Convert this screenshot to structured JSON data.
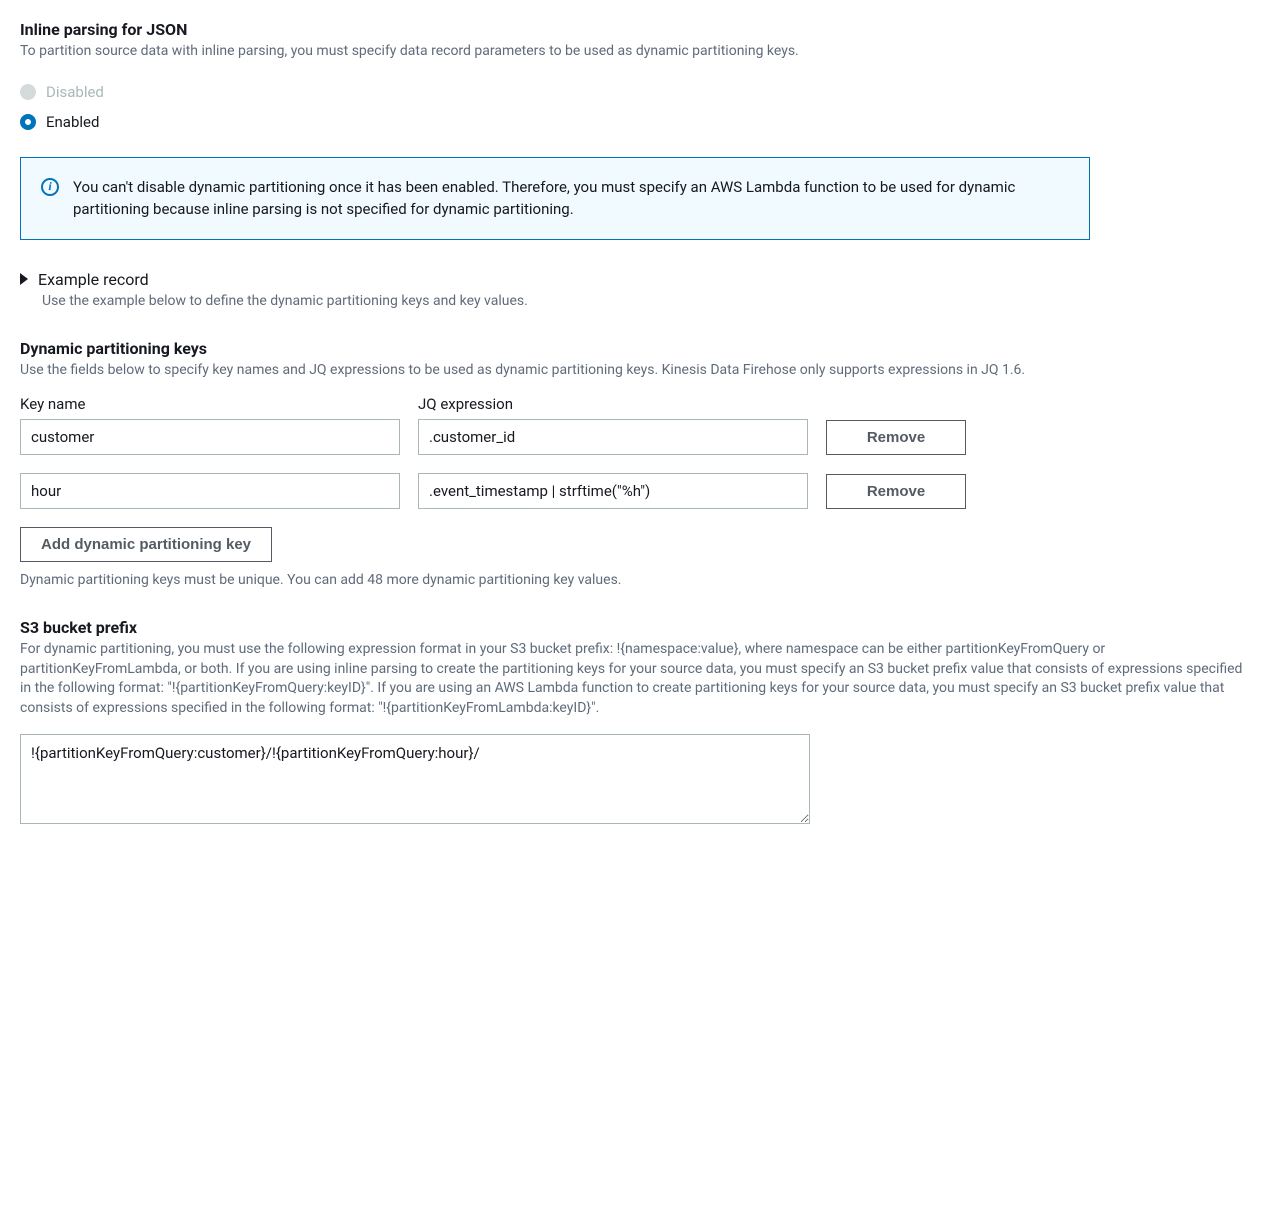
{
  "inlineParsing": {
    "title": "Inline parsing for JSON",
    "description": "To partition source data with inline parsing, you must specify data record parameters to be used as dynamic partitioning keys.",
    "options": {
      "disabled_label": "Disabled",
      "enabled_label": "Enabled"
    }
  },
  "alert": {
    "text": "You can't disable dynamic partitioning once it has been enabled. Therefore, you must specify an AWS Lambda function to be used for dynamic partitioning because inline parsing is not specified for dynamic partitioning."
  },
  "exampleRecord": {
    "title": "Example record",
    "description": "Use the example below to define the dynamic partitioning keys and key values."
  },
  "dynamicKeys": {
    "title": "Dynamic partitioning keys",
    "description": "Use the fields below to specify key names and JQ expressions to be used as dynamic partitioning keys. Kinesis Data Firehose only supports expressions in JQ 1.6.",
    "key_name_label": "Key name",
    "jq_label": "JQ expression",
    "rows": [
      {
        "key": "customer",
        "jq": ".customer_id",
        "remove": "Remove"
      },
      {
        "key": "hour",
        "jq": ".event_timestamp | strftime(\"%h\")",
        "remove": "Remove"
      }
    ],
    "add_button": "Add dynamic partitioning key",
    "hint": "Dynamic partitioning keys must be unique. You can add 48 more dynamic partitioning key values."
  },
  "s3prefix": {
    "title": "S3 bucket prefix",
    "description": "For dynamic partitioning, you must use the following expression format in your S3 bucket prefix: !{namespace:value}, where namespace can be either partitionKeyFromQuery or partitionKeyFromLambda, or both. If you are using inline parsing to create the partitioning keys for your source data, you must specify an S3 bucket prefix value that consists of expressions specified in the following format: \"!{partitionKeyFromQuery:keyID}\". If you are using an AWS Lambda function to create partitioning keys for your source data, you must specify an S3 bucket prefix value that consists of expressions specified in the following format: \"!{partitionKeyFromLambda:keyID}\".",
    "value": "!{partitionKeyFromQuery:customer}/!{partitionKeyFromQuery:hour}/"
  }
}
